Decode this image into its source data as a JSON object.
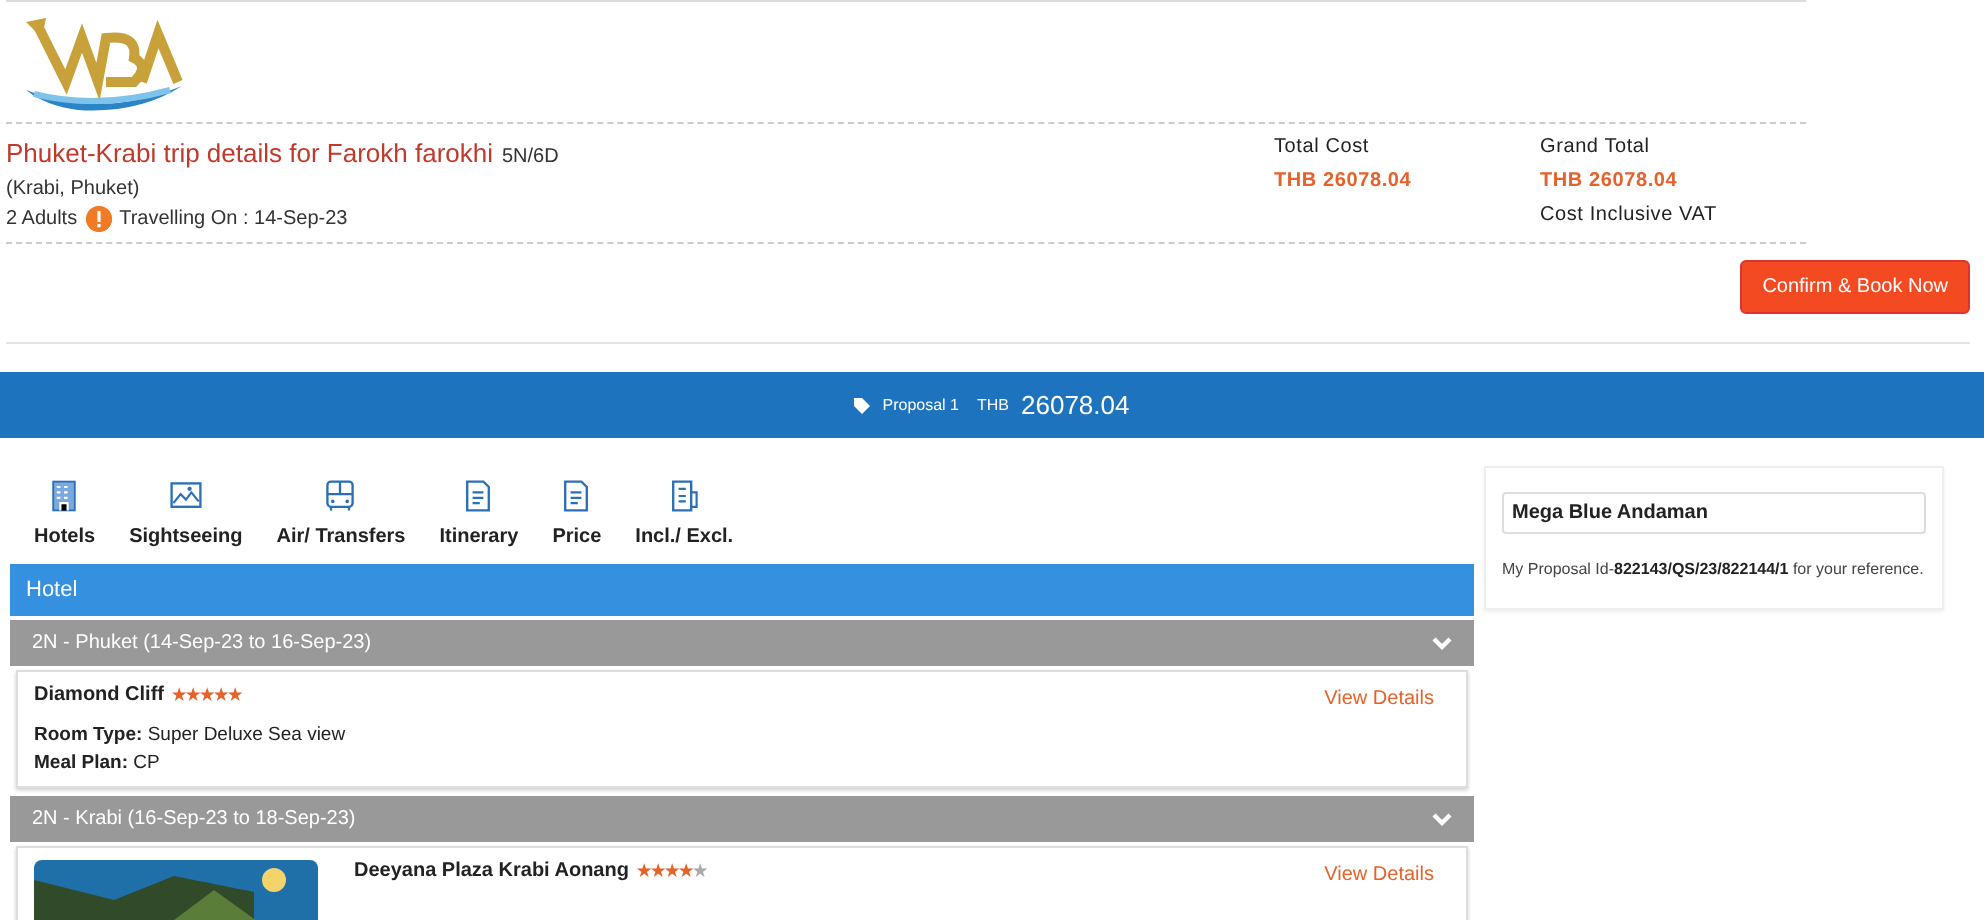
{
  "header": {
    "trip_title": "Phuket-Krabi trip details for Farokh farokhi",
    "duration": "5N/6D",
    "locations": "(Krabi, Phuket)",
    "adults": "2 Adults",
    "travelling_on": "Travelling On : 14-Sep-23",
    "total_cost_label": "Total Cost",
    "total_cost": "THB 26078.04",
    "grand_total_label": "Grand Total",
    "grand_total": "THB 26078.04",
    "vat_note": "Cost Inclusive VAT",
    "confirm_button": "Confirm & Book Now"
  },
  "proposal_bar": {
    "label": "Proposal 1",
    "currency": "THB",
    "amount": "26078.04"
  },
  "tabs": [
    {
      "label": "Hotels"
    },
    {
      "label": "Sightseeing"
    },
    {
      "label": "Air/ Transfers"
    },
    {
      "label": "Itinerary"
    },
    {
      "label": "Price"
    },
    {
      "label": "Incl./ Excl."
    }
  ],
  "section_title": "Hotel",
  "stays": [
    {
      "title": "2N - Phuket (14-Sep-23 to 16-Sep-23)",
      "hotel": {
        "name": "Diamond Cliff",
        "stars": 5,
        "has_picture": false,
        "room_type_label": "Room Type:",
        "room_type": "Super Deluxe Sea view",
        "meal_plan_label": "Meal Plan:",
        "meal_plan": "CP",
        "link": "View Details"
      }
    },
    {
      "title": "2N - Krabi (16-Sep-23 to 18-Sep-23)",
      "hotel": {
        "name": "Deeyana Plaza Krabi Aonang",
        "stars": 4,
        "has_picture": true,
        "link": "View Details"
      }
    }
  ],
  "side_card": {
    "name": "Mega Blue Andaman",
    "note_prefix": "My Proposal Id-",
    "proposal_id": "822143/QS/23/822144/1",
    "note_suffix": " for your reference."
  }
}
